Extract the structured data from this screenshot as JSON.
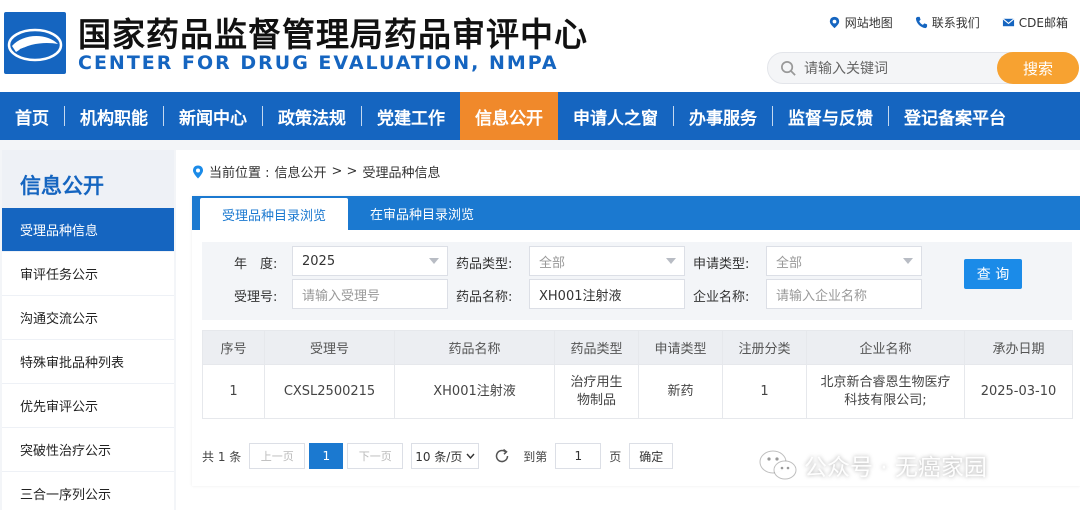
{
  "header": {
    "title_cn": "国家药品监督管理局药品审评中心",
    "title_en": "CENTER FOR DRUG EVALUATION, NMPA",
    "links": [
      {
        "label": "网站地图",
        "icon": "location-pin-icon"
      },
      {
        "label": "联系我们",
        "icon": "phone-icon"
      },
      {
        "label": "CDE邮箱",
        "icon": "mail-icon"
      }
    ],
    "search": {
      "placeholder": "请输入关键词",
      "button": "搜索"
    },
    "colors": {
      "brand_blue": "#1565c0",
      "accent_orange": "#f0892b",
      "search_orange": "#f7a231"
    }
  },
  "nav": {
    "items": [
      {
        "label": "首页"
      },
      {
        "label": "机构职能"
      },
      {
        "label": "新闻中心"
      },
      {
        "label": "政策法规"
      },
      {
        "label": "党建工作"
      },
      {
        "label": "信息公开",
        "active": true
      },
      {
        "label": "申请人之窗"
      },
      {
        "label": "办事服务"
      },
      {
        "label": "监督与反馈"
      },
      {
        "label": "登记备案平台"
      }
    ]
  },
  "sidebar": {
    "title": "信息公开",
    "items": [
      {
        "label": "受理品种信息",
        "active": true
      },
      {
        "label": "审评任务公示"
      },
      {
        "label": "沟通交流公示"
      },
      {
        "label": "特殊审批品种列表"
      },
      {
        "label": "优先审评公示"
      },
      {
        "label": "突破性治疗公示"
      },
      {
        "label": "三合一序列公示"
      }
    ]
  },
  "breadcrumb": {
    "prefix": "当前位置 :",
    "section": "信息公开",
    "sep": "> >",
    "current": "受理品种信息"
  },
  "tabs": [
    {
      "label": "受理品种目录浏览",
      "active": true
    },
    {
      "label": "在审品种目录浏览"
    }
  ],
  "filters": {
    "year_label": "年　度:",
    "year_value": "2025",
    "drug_type_label": "药品类型:",
    "drug_type_value": "全部",
    "apply_type_label": "申请类型:",
    "apply_type_value": "全部",
    "accept_no_label": "受理号:",
    "accept_no_placeholder": "请输入受理号",
    "drug_name_label": "药品名称:",
    "drug_name_value": "XH001注射液",
    "company_label": "企业名称:",
    "company_placeholder": "请输入企业名称",
    "query_button": "查 询"
  },
  "table": {
    "headers": [
      "序号",
      "受理号",
      "药品名称",
      "药品类型",
      "申请类型",
      "注册分类",
      "企业名称",
      "承办日期"
    ],
    "rows": [
      {
        "no": "1",
        "accept_no": "CXSL2500215",
        "drug_name": "XH001注射液",
        "drug_type_1": "治疗用生",
        "drug_type_2": "物制品",
        "apply_type": "新药",
        "reg_class": "1",
        "company_1": "北京新合睿恩生物医疗",
        "company_2": "科技有限公司;",
        "date": "2025-03-10"
      }
    ]
  },
  "pager": {
    "total": "共 1 条",
    "prev": "上一页",
    "current_page": "1",
    "next": "下一页",
    "page_size": "10 条/页",
    "goto_label": "到第",
    "goto_value": "1",
    "page_unit": "页",
    "confirm": "确定"
  },
  "watermark": {
    "text": "公众号 · 无癌家园"
  }
}
